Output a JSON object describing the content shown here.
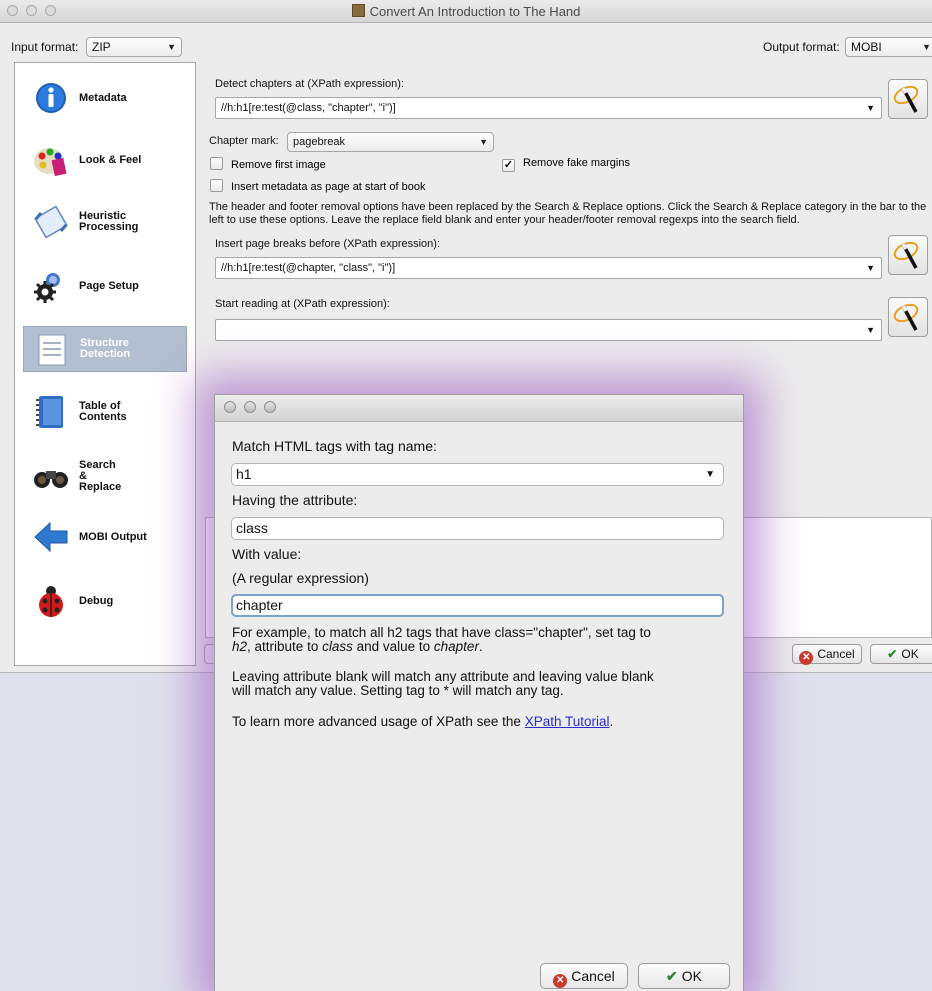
{
  "window": {
    "title": "Convert An Introduction to The Hand"
  },
  "formats": {
    "input_label": "Input format:",
    "input_value": "ZIP",
    "output_label": "Output format:",
    "output_value": "MOBI"
  },
  "sidebar": {
    "items": [
      {
        "label": "Metadata",
        "icon": "info-icon"
      },
      {
        "label": "Look & Feel",
        "icon": "palette-icon"
      },
      {
        "label": "Heuristic\nProcessing",
        "icon": "heuristic-icon"
      },
      {
        "label": "Page Setup",
        "icon": "gear-icon"
      },
      {
        "label": "Structure\nDetection",
        "icon": "document-icon",
        "selected": true
      },
      {
        "label": "Table of\nContents",
        "icon": "book-icon"
      },
      {
        "label": "Search\n&\nReplace",
        "icon": "binoculars-icon"
      },
      {
        "label": "MOBI Output",
        "icon": "arrow-left-icon"
      },
      {
        "label": "Debug",
        "icon": "ladybug-icon"
      }
    ]
  },
  "structure": {
    "detect_label": "Detect chapters at (XPath expression):",
    "detect_value": "//h:h1[re:test(@class, \"chapter\", \"i\")]",
    "chapter_mark_label": "Chapter mark:",
    "chapter_mark_value": "pagebreak",
    "remove_first_image": "Remove first image",
    "remove_fake_margins": "Remove fake margins",
    "remove_fake_margins_checked": true,
    "insert_metadata": "Insert metadata as page at start of book",
    "info_text": "The header and footer removal options have been replaced by the Search & Replace options. Click the Search & Replace category in the bar to the left to use these options. Leave the replace field blank and enter your header/footer removal regexps into the search field.",
    "page_breaks_label": "Insert page breaks before (XPath expression):",
    "page_breaks_value": "//h:h1[re:test(@chapter, \"class\", \"i\")]",
    "start_reading_label": "Start reading at (XPath expression):",
    "start_reading_value": ""
  },
  "main_buttons": {
    "cancel": "Cancel",
    "ok": "OK"
  },
  "dialog": {
    "tag_label": "Match HTML tags with tag name:",
    "tag_value": "h1",
    "attr_label": "Having the attribute:",
    "attr_value": "class",
    "value_label": "With value:",
    "regex_note": "(A regular expression)",
    "value_value": "chapter",
    "example_1": "For example, to match all h2 tags that have class=\"chapter\", set tag to",
    "example_2_a": "h2",
    "example_2_b": ", attribute to ",
    "example_2_c": "class",
    "example_2_d": " and value to ",
    "example_2_e": "chapter",
    "example_2_f": ".",
    "blank_1": "Leaving attribute blank will match any attribute and leaving value blank",
    "blank_2": "will match any value. Setting tag to * will match any tag.",
    "learn_prefix": "To learn more advanced usage of XPath see the ",
    "learn_link": "XPath Tutorial",
    "learn_suffix": ".",
    "cancel": "Cancel",
    "ok": "OK"
  }
}
